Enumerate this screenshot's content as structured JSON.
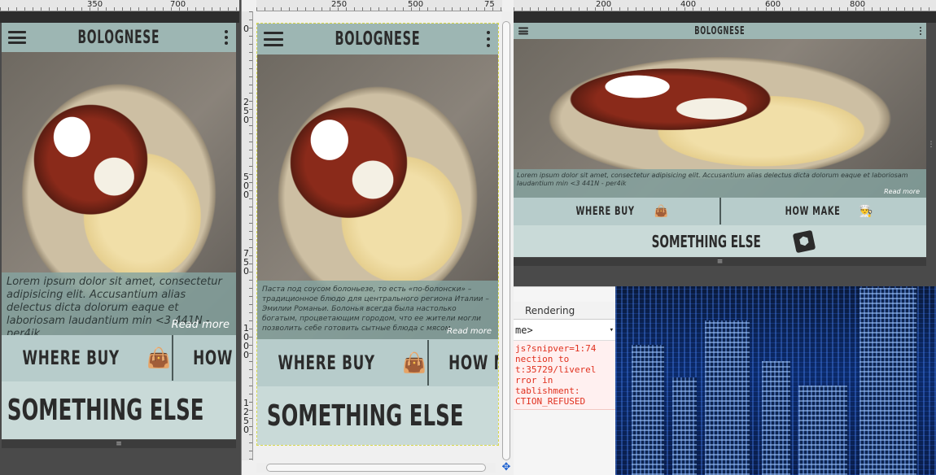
{
  "rulers": {
    "left": [
      "350",
      "700"
    ],
    "middle": [
      "250",
      "500",
      "75"
    ],
    "right": [
      "200",
      "400",
      "600",
      "800"
    ],
    "vertical_middle": [
      "0",
      "250",
      "500",
      "750",
      "1000",
      "1250"
    ]
  },
  "app": {
    "title": "BOLOGNESE",
    "caption_en": "Lorem ipsum dolor sit amet, consectetur adipisicing elit. Accusantium alias delectus dicta dolorum eaque et laboriosam laudantium min <3 441N - per4ik",
    "caption_ru": "Паста под соусом болоньезе, то есть «по-болонски» – традиционное блюдо для центрального региона Италии – Эмилии Романьи. Болонья всегда была настолько богатым, процветающим городом, что ее жители могли позволить себе готовить сытные блюда с мясом.",
    "read_more": "Read more",
    "where_buy": "WHERE BUY",
    "how_make": "HOW MAKE",
    "something_else": "SOMETHING ELSE",
    "handle": "≡"
  },
  "icons": {
    "menu": "hamburger-icon",
    "more": "vertical-dots-icon",
    "shop": "shopping-bag-icon",
    "chef": "chef-hat-icon",
    "box": "box-icon"
  },
  "devtools": {
    "tab_rendering": "Rendering",
    "context": "me>",
    "error_lines": [
      "js?snipver=1:74",
      "nection to",
      "t:35729/liverel",
      "rror in",
      "tablishment:",
      "CTION_REFUSED"
    ]
  },
  "colors": {
    "topbar": "#9db6b3",
    "button_bg": "#b7cccb",
    "accent_text": "#2b2b2b",
    "error": "#e0301e"
  }
}
